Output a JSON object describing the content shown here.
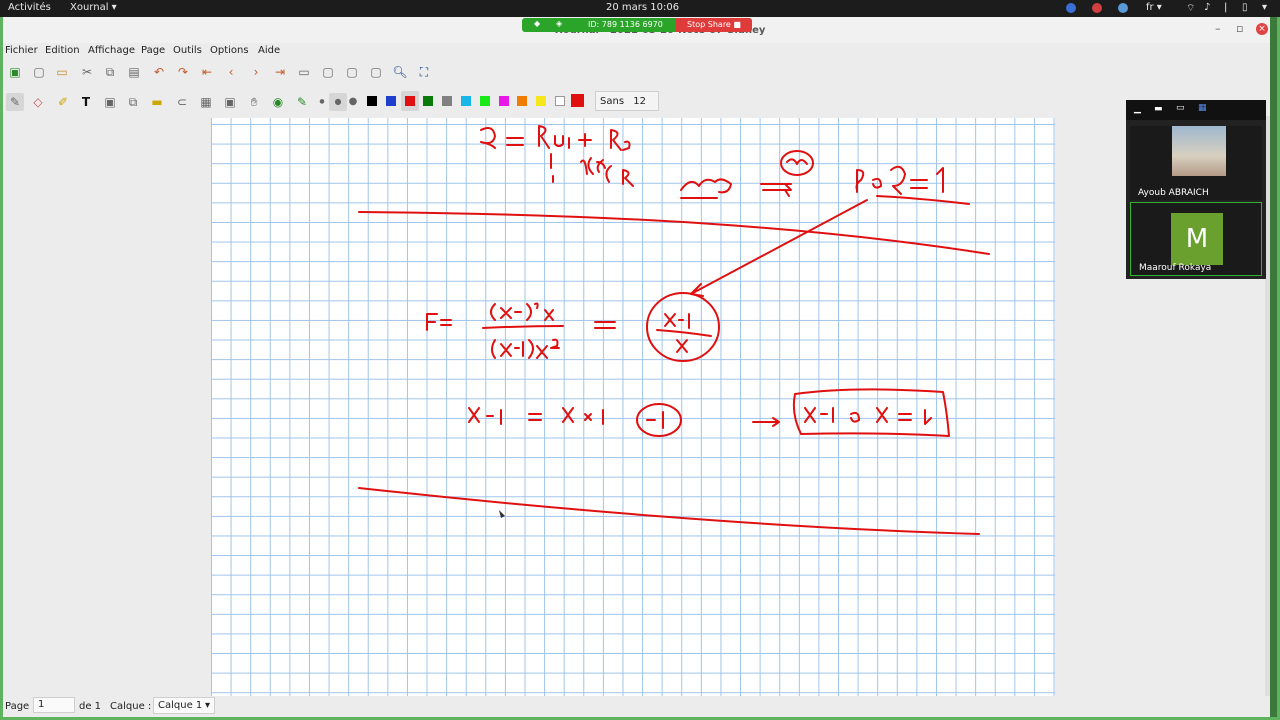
{
  "topbar": {
    "activities": "Activités",
    "app_name": "Xournal ▾",
    "clock": "20 mars  10:06",
    "lang": "fr ▾"
  },
  "share": {
    "meeting_id": "ID: 789 1136 6970",
    "stop_label": "Stop Share"
  },
  "window": {
    "title": "Xournal - 2021-03-20-Note-07-Sidney",
    "menu": [
      "Fichier",
      "Edition",
      "Affichage",
      "Page",
      "Outils",
      "Options",
      "Aide"
    ]
  },
  "toolbar2": {
    "font_name": "Sans",
    "font_size": "12",
    "extra": "0",
    "colors": [
      "#000000",
      "#1e3fcc",
      "#e01010",
      "#0a7a0a",
      "#808080",
      "#19b7e8",
      "#19e819",
      "#e819e8",
      "#f07c00",
      "#f5e61e",
      "#ffffff"
    ],
    "selected_color": "#e01010"
  },
  "statusbar": {
    "page_label": "Page",
    "page_value": "1",
    "page_of": "de 1",
    "layer_label": "Calque :",
    "layer_value": "Calque 1"
  },
  "zoom": {
    "participants": [
      {
        "name": "Ayoub ABRAICH"
      },
      {
        "name": "Maarouf Rokaya",
        "initial": "M"
      }
    ]
  }
}
